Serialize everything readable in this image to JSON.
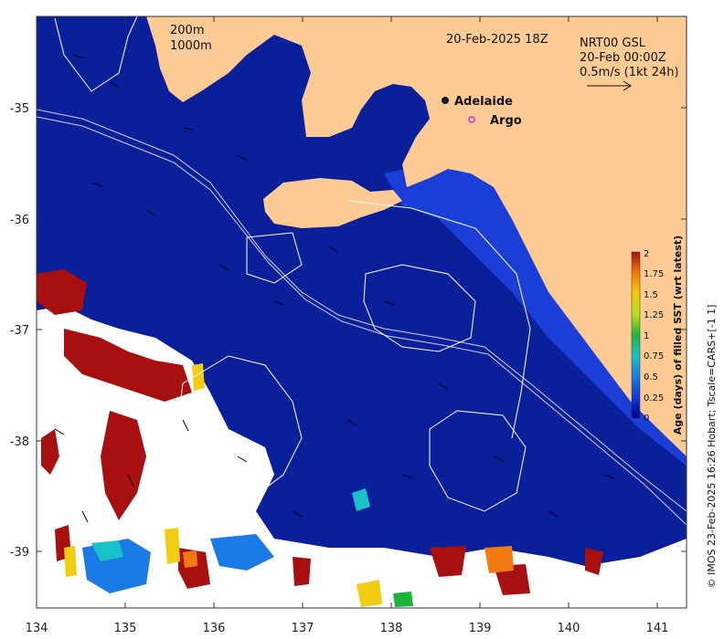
{
  "map": {
    "timestamp": "20-Feb-2025 18Z",
    "contours": [
      "200m",
      "1000m"
    ],
    "product": "NRT00 GSL",
    "product_time": "20-Feb 00:00Z",
    "velocity_scale": "0.5m/s (1kt 24h)",
    "credit": "© IMOS 23-Feb-2025 16:26 Hobart; Tscale=CARS+[-1 1]",
    "lon_ticks": [
      "134",
      "135",
      "136",
      "137",
      "138",
      "139",
      "140",
      "141"
    ],
    "lat_ticks": [
      "-35",
      "-36",
      "-37",
      "-38",
      "-39"
    ],
    "places": [
      {
        "name": "Adelaide",
        "marker": "black-dot"
      },
      {
        "name": "Argo",
        "marker": "magenta-circle"
      }
    ],
    "colors": {
      "land": "#fdcb93",
      "ocean": "#0a1f9a",
      "ocean_light": "#1a3ed6",
      "age_two_days": "#a80f0f"
    }
  },
  "colorbar": {
    "title": "Age (days) of filled SST (wrt latest)",
    "ticks": [
      "0",
      "0.25",
      "0.5",
      "0.75",
      "1",
      "1.25",
      "1.5",
      "1.75",
      "2"
    ],
    "colors": [
      "#00008f",
      "#0a3cd6",
      "#1a7ae6",
      "#19c1c9",
      "#1eb43a",
      "#b6e01b",
      "#f2cc10",
      "#f07a10",
      "#a80f0f"
    ]
  }
}
